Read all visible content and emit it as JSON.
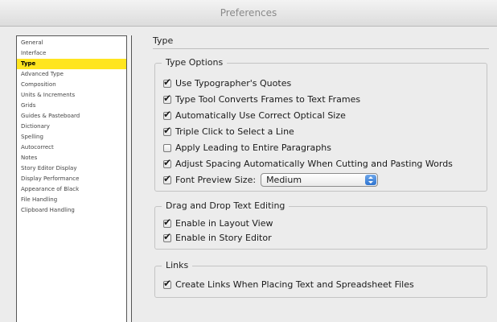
{
  "window": {
    "title": "Preferences"
  },
  "sidebar": {
    "items": [
      "General",
      "Interface",
      "Type",
      "Advanced Type",
      "Composition",
      "Units & Increments",
      "Grids",
      "Guides & Pasteboard",
      "Dictionary",
      "Spelling",
      "Autocorrect",
      "Notes",
      "Story Editor Display",
      "Display Performance",
      "Appearance of Black",
      "File Handling",
      "Clipboard Handling"
    ],
    "selected": "Type"
  },
  "panel": {
    "title": "Type",
    "type_options": {
      "legend": "Type Options",
      "items": [
        {
          "label": "Use Typographer's Quotes",
          "checked": true
        },
        {
          "label": "Type Tool Converts Frames to Text Frames",
          "checked": true
        },
        {
          "label": "Automatically Use Correct Optical Size",
          "checked": true
        },
        {
          "label": "Triple Click to Select a Line",
          "checked": true
        },
        {
          "label": "Apply Leading to Entire Paragraphs",
          "checked": false
        },
        {
          "label": "Adjust Spacing Automatically When Cutting and Pasting Words",
          "checked": true
        },
        {
          "label": "Font Preview Size:",
          "checked": true
        }
      ],
      "font_preview_size": "Medium"
    },
    "drag_drop": {
      "legend": "Drag and Drop Text Editing",
      "items": [
        {
          "label": "Enable in Layout View",
          "checked": true
        },
        {
          "label": "Enable in Story Editor",
          "checked": true
        }
      ]
    },
    "links": {
      "legend": "Links",
      "items": [
        {
          "label": "Create Links When Placing Text and Spreadsheet Files",
          "checked": true
        }
      ]
    }
  }
}
